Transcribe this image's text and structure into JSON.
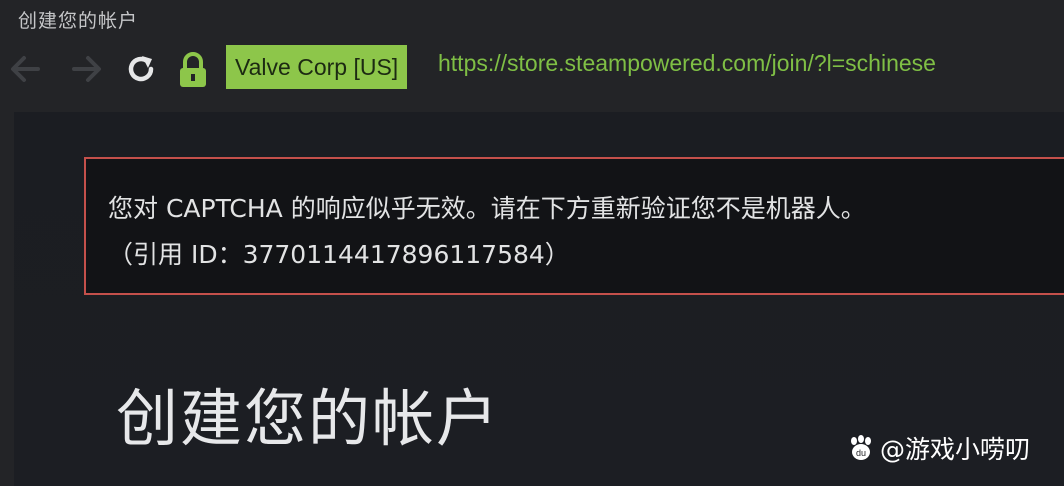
{
  "window": {
    "title": "创建您的帐户"
  },
  "toolbar": {
    "back_icon": "arrow-left-icon",
    "forward_icon": "arrow-right-icon",
    "reload_icon": "reload-icon",
    "lock_icon": "lock-icon",
    "certificate": "Valve Corp [US]",
    "url": "https://store.steampowered.com/join/?l=schinese"
  },
  "error": {
    "message_line1": "您对 CAPTCHA 的响应似乎无效。请在下方重新验证您不是机器人。",
    "message_line2": "（引用 ID：3770114417896117584）"
  },
  "main": {
    "heading": "创建您的帐户"
  },
  "watermark": {
    "text": "@游戏小唠叨"
  },
  "colors": {
    "background": "#232427",
    "cert_badge": "#8dc64a",
    "url_text": "#7fbf45",
    "error_border": "#c4504b",
    "error_bg": "#121316"
  }
}
